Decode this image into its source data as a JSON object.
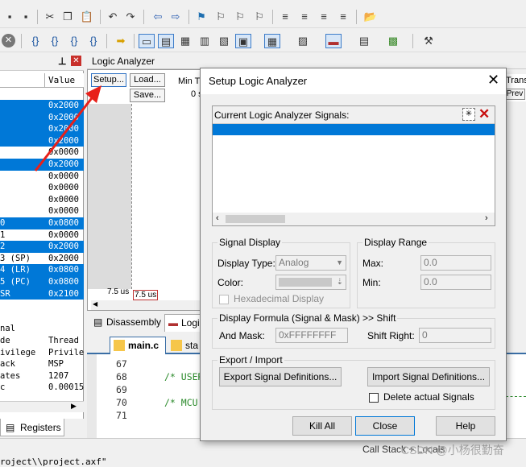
{
  "registers": {
    "header_value": "Value",
    "rows": [
      {
        "name": "",
        "value": "0x2000",
        "sel": true
      },
      {
        "name": "",
        "value": "0x2000",
        "sel": true
      },
      {
        "name": "",
        "value": "0x2000",
        "sel": true
      },
      {
        "name": "",
        "value": "0x2000",
        "sel": true
      },
      {
        "name": "",
        "value": "0x0000",
        "sel": false
      },
      {
        "name": "",
        "value": "0x2000",
        "sel": true
      },
      {
        "name": "",
        "value": "0x0000",
        "sel": false
      },
      {
        "name": "",
        "value": "0x0000",
        "sel": false
      },
      {
        "name": "",
        "value": "0x0000",
        "sel": false
      },
      {
        "name": "",
        "value": "0x0000",
        "sel": false
      },
      {
        "name": "0",
        "value": "0x0800",
        "sel": true
      },
      {
        "name": "1",
        "value": "0x0000",
        "sel": false
      },
      {
        "name": "2",
        "value": "0x2000",
        "sel": true
      },
      {
        "name": "3 (SP)",
        "value": "0x2000",
        "sel": false
      },
      {
        "name": "4 (LR)",
        "value": "0x0800",
        "sel": true
      },
      {
        "name": "5 (PC)",
        "value": "0x0800",
        "sel": true
      },
      {
        "name": "SR",
        "value": "0x2100",
        "sel": true
      },
      {
        "name": "",
        "value": "",
        "sel": false
      },
      {
        "name": "",
        "value": "",
        "sel": false
      },
      {
        "name": "nal",
        "value": "",
        "sel": false
      },
      {
        "name": "de",
        "value": "Thread",
        "sel": false
      },
      {
        "name": "ivilege",
        "value": "Privile",
        "sel": false
      },
      {
        "name": "ack",
        "value": "MSP",
        "sel": false
      },
      {
        "name": "ates",
        "value": "1207",
        "sel": false
      },
      {
        "name": "c",
        "value": "0.00015",
        "sel": false
      }
    ],
    "tab_label": "Registers"
  },
  "logic_analyzer": {
    "title": "Logic Analyzer",
    "setup_btn": "Setup...",
    "load_btn": "Load...",
    "save_btn": "Save...",
    "min_label": "Min Ti",
    "zero": "0 s",
    "cursor_a": "7.5 us",
    "cursor_b": "7.5 us",
    "right_label": "Transi",
    "prev_btn": "Prev"
  },
  "tabs": {
    "disassembly": "Disassembly",
    "logic": "Logic",
    "main_c": "main.c",
    "sta": "sta"
  },
  "editor": {
    "lines": [
      {
        "num": "67",
        "text": ""
      },
      {
        "num": "68",
        "text": "/* USER"
      },
      {
        "num": "69",
        "text": ""
      },
      {
        "num": "70",
        "text": "/* MCU"
      },
      {
        "num": "71",
        "text": ""
      }
    ]
  },
  "dialog": {
    "title": "Setup Logic Analyzer",
    "signals_label": "Current Logic Analyzer Signals:",
    "signal_display": {
      "group": "Signal Display",
      "display_type_label": "Display Type:",
      "display_type_value": "Analog",
      "color_label": "Color:",
      "hex_label": "Hexadecimal Display"
    },
    "display_range": {
      "group": "Display Range",
      "max_label": "Max:",
      "max_value": "0.0",
      "min_label": "Min:",
      "min_value": "0.0"
    },
    "formula": {
      "group": "Display Formula (Signal & Mask) >> Shift",
      "and_mask_label": "And Mask:",
      "and_mask_value": "0xFFFFFFFF",
      "shift_label": "Shift Right:",
      "shift_value": "0"
    },
    "export_import": {
      "group": "Export / Import",
      "export_btn": "Export Signal Definitions...",
      "import_btn": "Import Signal Definitions...",
      "delete_label": "Delete actual Signals"
    },
    "kill_all_btn": "Kill All",
    "close_btn": "Close",
    "help_btn": "Help"
  },
  "status": {
    "path": "roject\\\\project.axf\"",
    "call_stack": "Call Stack + Locals",
    "watermark": "CSDN @小杨很勤奋"
  },
  "colors": {
    "selection": "#0078d7",
    "arrow": "#e8201a"
  }
}
